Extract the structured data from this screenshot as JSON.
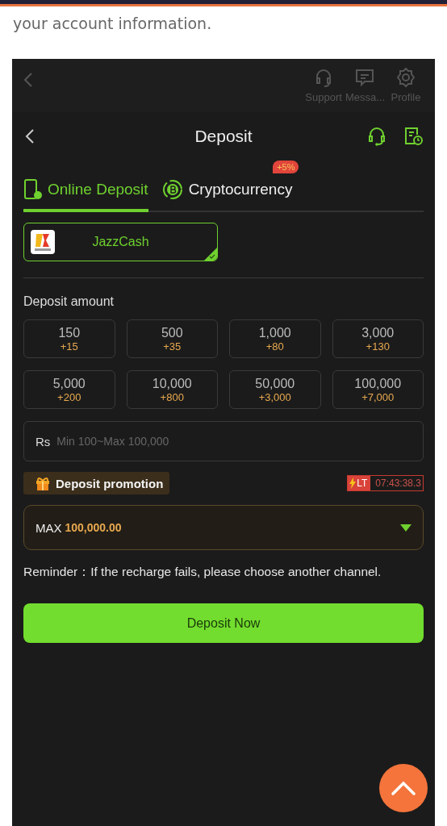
{
  "article": {
    "text": "your account information."
  },
  "background_header": {
    "items": [
      {
        "label": "Support",
        "kind": "headset"
      },
      {
        "label": "Messa...",
        "kind": "message"
      },
      {
        "label": "Profile",
        "kind": "gear"
      }
    ]
  },
  "header": {
    "title": "Deposit"
  },
  "tabs": [
    {
      "label": "Online Deposit",
      "selected": true,
      "kind": "phone"
    },
    {
      "label": "Cryptocurrency",
      "selected": false,
      "kind": "coin",
      "badge": "+5%"
    }
  ],
  "channels": [
    {
      "name": "JazzCash",
      "selected": true
    }
  ],
  "amount": {
    "label": "Deposit amount",
    "options": [
      {
        "amount": "150",
        "bonus": "+15"
      },
      {
        "amount": "500",
        "bonus": "+35"
      },
      {
        "amount": "1,000",
        "bonus": "+80"
      },
      {
        "amount": "3,000",
        "bonus": "+130"
      },
      {
        "amount": "5,000",
        "bonus": "+200"
      },
      {
        "amount": "10,000",
        "bonus": "+800"
      },
      {
        "amount": "50,000",
        "bonus": "+3,000"
      },
      {
        "amount": "100,000",
        "bonus": "+7,000"
      }
    ],
    "input": {
      "prefix": "Rs",
      "placeholder": "Min 100~Max 100,000"
    }
  },
  "promotion": {
    "label": "Deposit promotion",
    "timer_tag": "LT",
    "timer": "07:43:38.3",
    "select": {
      "prefix": "MAX",
      "value": "100,000.00"
    }
  },
  "reminder": "Reminder：If the recharge fails, please choose another channel.",
  "submit": "Deposit Now"
}
